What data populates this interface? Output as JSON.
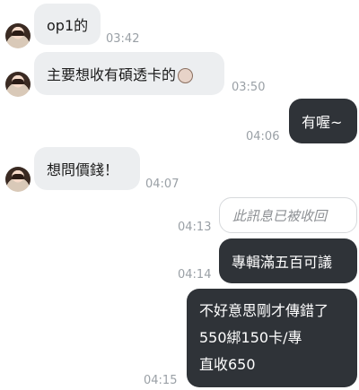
{
  "messages": [
    {
      "side": "in",
      "text": "op1的",
      "time": "03:42"
    },
    {
      "side": "in",
      "text": "主要想收有碩透卡的",
      "emoji": "face-icon",
      "time": "03:50"
    },
    {
      "side": "out",
      "text": "有喔~",
      "time": "04:06"
    },
    {
      "side": "in",
      "text": "想問價錢！",
      "time": "04:07"
    },
    {
      "side": "out",
      "recalled": true,
      "text": "此訊息已被收回",
      "time": "04:13"
    },
    {
      "side": "out",
      "text": "專輯滿五百可議",
      "time": "04:14"
    },
    {
      "side": "out",
      "lines": [
        "不好意思剛才傳錯了",
        "550綁150卡/專",
        "直收650"
      ],
      "time": "04:15"
    }
  ],
  "colors": {
    "incoming_bubble": "#eceef0",
    "outgoing_bubble": "#2f3338",
    "timestamp": "#9aa0a6"
  }
}
